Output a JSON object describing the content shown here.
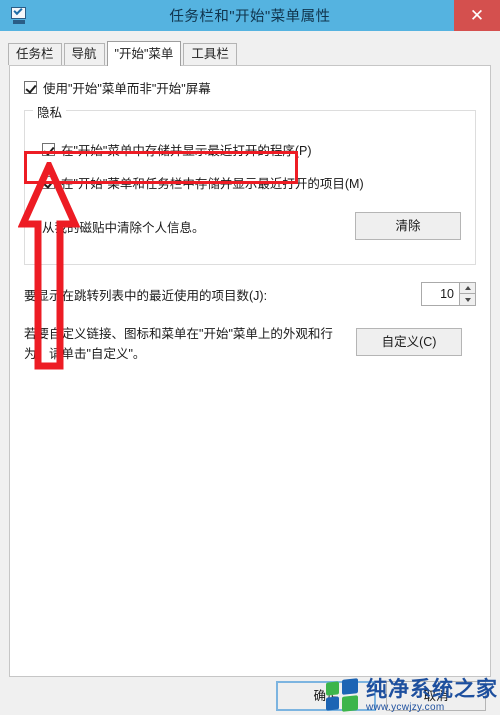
{
  "window": {
    "title": "任务栏和\"开始\"菜单属性",
    "icon": "taskbar-properties-icon",
    "close_label": "✕"
  },
  "tabs": [
    {
      "label": "任务栏",
      "active": false
    },
    {
      "label": "导航",
      "active": false
    },
    {
      "label": "\"开始\"菜单",
      "active": true
    },
    {
      "label": "工具栏",
      "active": false
    }
  ],
  "main_checkbox": {
    "label": "使用\"开始\"菜单而非\"开始\"屏幕",
    "checked": true
  },
  "privacy_group": {
    "legend": "隐私",
    "checkboxes": [
      {
        "label": "在\"开始\"菜单中存储并显示最近打开的程序(P)",
        "checked": true
      },
      {
        "label": "在\"开始\"菜单和任务栏中存储并显示最近打开的项目(M)",
        "checked": true
      }
    ],
    "clear_text": "从我的磁贴中清除个人信息。",
    "clear_button": "清除"
  },
  "jump_list": {
    "label": "要显示在跳转列表中的最近使用的项目数(J):",
    "value": "10"
  },
  "customize": {
    "text": "若要自定义链接、图标和菜单在\"开始\"菜单上的外观和行为，请单击\"自定义\"。",
    "button": "自定义(C)"
  },
  "footer": {
    "ok": "确定",
    "cancel": "取消"
  },
  "annotations": {
    "highlight_color": "#ed1c24",
    "arrow_color": "#ed1c24"
  },
  "watermark": {
    "name": "纯净系统之家",
    "url": "www.ycwjzy.com"
  }
}
